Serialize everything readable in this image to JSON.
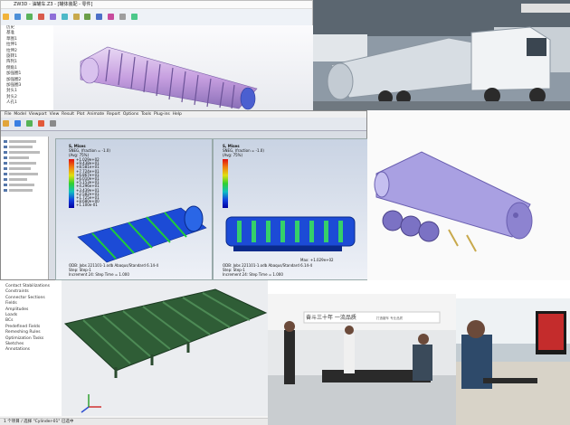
{
  "cad_window": {
    "title": "ZW3D - 油罐车.Z3 - [罐体装配 - 零件]",
    "tree_items": [
      "历史",
      "基准",
      "草图1",
      "拉伸1",
      "拉伸2",
      "旋转1",
      "阵列1",
      "倒角1",
      "加强圈1",
      "加强圈2",
      "加强圈3",
      "封头1",
      "封头2",
      "人孔1"
    ]
  },
  "fem_window": {
    "menu": [
      "File",
      "Model",
      "Viewport",
      "View",
      "Result",
      "Plot",
      "Animate",
      "Report",
      "Options",
      "Tools",
      "Plug-ins",
      "Help"
    ],
    "left_panel": {
      "title_top": "S, Mises",
      "subtitle": "SNEG, (fraction = -1.0)",
      "avg": "(Avg: 75%)",
      "legend": [
        "+1.029e+02",
        "+9.438e+01",
        "+8.581e+01",
        "+7.724e+01",
        "+6.867e+01",
        "+6.010e+01",
        "+5.153e+01",
        "+4.296e+01",
        "+3.439e+01",
        "+2.582e+01",
        "+1.725e+01",
        "+8.680e+00",
        "+1.100e-01"
      ],
      "footer1": "ODB: Jobs 221101-1.odb   Abaqus/Standard 6.14-4",
      "footer2": "Step: Step-1",
      "footer3": "Increment 24: Step Time = 1.000"
    },
    "right_panel": {
      "title_top": "S, Mises",
      "subtitle": "SNEG, (fraction = -1.0)",
      "avg": "(Avg: 75%)",
      "max": "Max: +1.029e+02",
      "footer1": "ODB: Jobs 221101-1.odb   Abaqus/Standard 6.14-4",
      "footer2": "Step: Step-1",
      "footer3": "Increment 24: Step Time = 1.000"
    }
  },
  "lower_cad": {
    "tree_items": [
      "Contact Stabilizations",
      "Constraints",
      "Connector Sections",
      "Fields",
      "Amplitudes",
      "Loads",
      "BCs",
      "Predefined Fields",
      "Remeshing Rules",
      "Optimization Tasks",
      "Sketches",
      "Annotations"
    ],
    "status": "1 个项目 / 选择 \"Cylinder-01\" 已选中"
  },
  "office_photo": {
    "banner": "奋斗三十年 一流品质",
    "banner_sub": "打造罐车 专业品质"
  },
  "colors": {
    "tank_purple": "#a9a0e2",
    "fem_blue": "#1c4bd6",
    "fem_green": "#1ecb3a",
    "truck_white": "#e9ecef",
    "green_model": "#2f5d36"
  }
}
